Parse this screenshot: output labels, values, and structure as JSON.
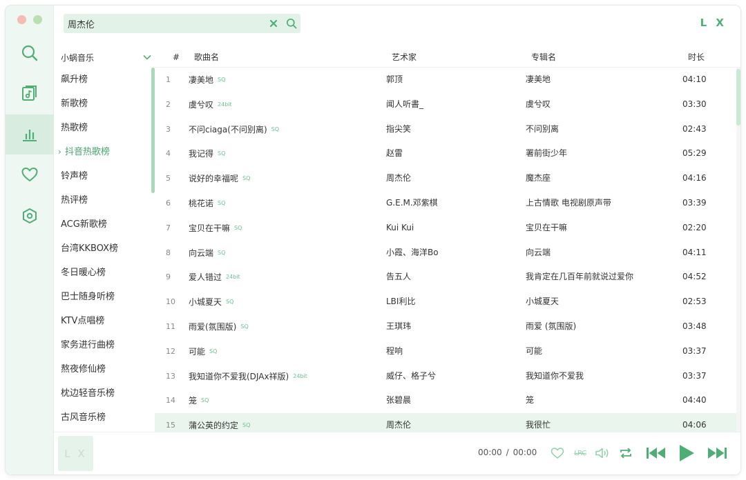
{
  "brand": "L X",
  "search": {
    "value": "周杰伦"
  },
  "source": {
    "label": "小蜗音乐"
  },
  "boards": [
    {
      "label": "飙升榜"
    },
    {
      "label": "新歌榜"
    },
    {
      "label": "热歌榜"
    },
    {
      "label": "抖音热歌榜",
      "active": true
    },
    {
      "label": "铃声榜"
    },
    {
      "label": "热评榜"
    },
    {
      "label": "ACG新歌榜"
    },
    {
      "label": "台湾KKBOX榜"
    },
    {
      "label": "冬日暖心榜"
    },
    {
      "label": "巴士随身听榜"
    },
    {
      "label": "KTV点唱榜"
    },
    {
      "label": "家务进行曲榜"
    },
    {
      "label": "熬夜修仙榜"
    },
    {
      "label": "枕边轻音乐榜"
    },
    {
      "label": "古风音乐榜"
    }
  ],
  "table": {
    "headers": {
      "num": "#",
      "name": "歌曲名",
      "artist": "艺术家",
      "album": "专辑名",
      "duration": "时长"
    },
    "rows": [
      {
        "num": "1",
        "name": "凄美地",
        "badge": "SQ",
        "artist": "郭顶",
        "album": "凄美地",
        "duration": "04:10"
      },
      {
        "num": "2",
        "name": "虞兮叹",
        "badge": "24bit",
        "artist": "闻人听書_",
        "album": "虞兮叹",
        "duration": "03:30"
      },
      {
        "num": "3",
        "name": "不问ciaga(不问别离)",
        "badge": "SQ",
        "artist": "指尖笑",
        "album": "不问别离",
        "duration": "02:43"
      },
      {
        "num": "4",
        "name": "我记得",
        "badge": "SQ",
        "artist": "赵雷",
        "album": "署前街少年",
        "duration": "05:29"
      },
      {
        "num": "5",
        "name": "说好的幸福呢",
        "badge": "SQ",
        "artist": "周杰伦",
        "album": "魔杰座",
        "duration": "04:16"
      },
      {
        "num": "6",
        "name": "桃花诺",
        "badge": "SQ",
        "artist": "G.E.M.邓紫棋",
        "album": "上古情歌 电视剧原声带",
        "duration": "03:39"
      },
      {
        "num": "7",
        "name": "宝贝在干嘛",
        "badge": "SQ",
        "artist": "Kui Kui",
        "album": "宝贝在干嘛",
        "duration": "02:20"
      },
      {
        "num": "8",
        "name": "向云端",
        "badge": "SQ",
        "artist": "小霞、海洋Bo",
        "album": "向云端",
        "duration": "04:11"
      },
      {
        "num": "9",
        "name": "爱人错过",
        "badge": "24bit",
        "artist": "告五人",
        "album": "我肯定在几百年前就说过爱你",
        "duration": "04:52"
      },
      {
        "num": "10",
        "name": "小城夏天",
        "badge": "SQ",
        "artist": "LBI利比",
        "album": "小城夏天",
        "duration": "02:53"
      },
      {
        "num": "11",
        "name": "雨爱(氛围版)",
        "badge": "SQ",
        "artist": "王琪玮",
        "album": "雨爱 (氛围版)",
        "duration": "03:48"
      },
      {
        "num": "12",
        "name": "可能",
        "badge": "SQ",
        "artist": "程响",
        "album": "可能",
        "duration": "03:37"
      },
      {
        "num": "13",
        "name": "我知道你不爱我(DJAx祥版)",
        "badge": "24bit",
        "artist": "威仔、格子兮",
        "album": "我知道你不爱我",
        "duration": "03:37"
      },
      {
        "num": "14",
        "name": "笼",
        "badge": "SQ",
        "artist": "张碧晨",
        "album": "笼",
        "duration": "04:40"
      },
      {
        "num": "15",
        "name": "蒲公英的约定",
        "badge": "SQ",
        "artist": "周杰伦",
        "album": "我很忙",
        "duration": "04:06",
        "highlight": true
      }
    ]
  },
  "player": {
    "cover_text": "L X",
    "current_time": "00:00",
    "separator": "/",
    "total_time": "00:00",
    "lrc_label": "LRC"
  },
  "colors": {
    "accent": "#4fae76",
    "rail_bg": "#eef7f1",
    "highlight": "#e9f5ed"
  }
}
